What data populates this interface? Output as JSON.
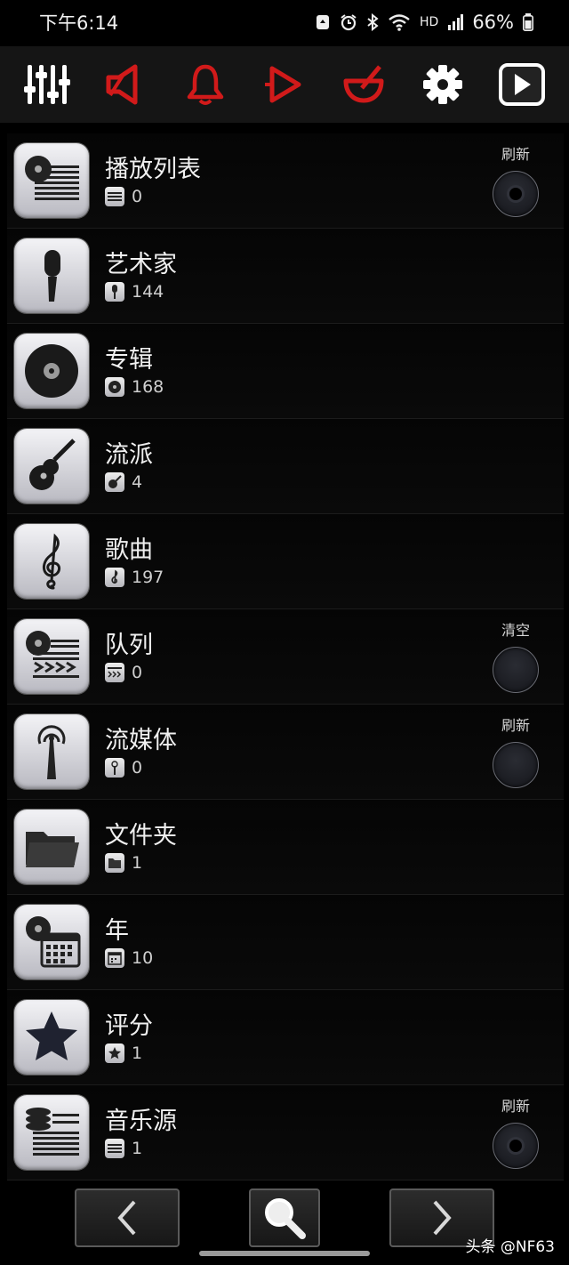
{
  "status_bar": {
    "time": "下午6:14",
    "network": "HD",
    "battery": "66%"
  },
  "toolbar": {
    "buttons": [
      {
        "name": "equalizer",
        "icon": "equalizer-icon",
        "color": "#ffffff"
      },
      {
        "name": "speaker",
        "icon": "speaker-icon",
        "color": "#d11a1a"
      },
      {
        "name": "bell",
        "icon": "bell-icon",
        "color": "#d11a1a"
      },
      {
        "name": "play-outline",
        "icon": "play-outline-icon",
        "color": "#d11a1a"
      },
      {
        "name": "bowl",
        "icon": "bowl-icon",
        "color": "#d11a1a"
      },
      {
        "name": "settings",
        "icon": "gear-icon",
        "color": "#ffffff"
      },
      {
        "name": "play",
        "icon": "play-box-icon",
        "color": "#ffffff"
      }
    ]
  },
  "library": {
    "items": [
      {
        "title": "播放列表",
        "count": "0",
        "icon": "playlist-icon",
        "action": "刷新",
        "knob": "dot"
      },
      {
        "title": "艺术家",
        "count": "144",
        "icon": "microphone-icon"
      },
      {
        "title": "专辑",
        "count": "168",
        "icon": "disc-icon"
      },
      {
        "title": "流派",
        "count": "4",
        "icon": "guitar-icon"
      },
      {
        "title": "歌曲",
        "count": "197",
        "icon": "treble-clef-icon"
      },
      {
        "title": "队列",
        "count": "0",
        "icon": "queue-icon",
        "action": "清空",
        "knob": "plain"
      },
      {
        "title": "流媒体",
        "count": "0",
        "icon": "antenna-icon",
        "action": "刷新",
        "knob": "plain"
      },
      {
        "title": "文件夹",
        "count": "1",
        "icon": "folder-icon"
      },
      {
        "title": "年",
        "count": "10",
        "icon": "calendar-icon"
      },
      {
        "title": "评分",
        "count": "1",
        "icon": "star-icon"
      },
      {
        "title": "音乐源",
        "count": "1",
        "icon": "music-source-icon",
        "action": "刷新",
        "knob": "dot"
      }
    ]
  },
  "bottom_nav": {
    "prev": "chevron-left-icon",
    "search": "search-icon",
    "next": "chevron-right-icon"
  },
  "watermark": "头条 @NF63"
}
